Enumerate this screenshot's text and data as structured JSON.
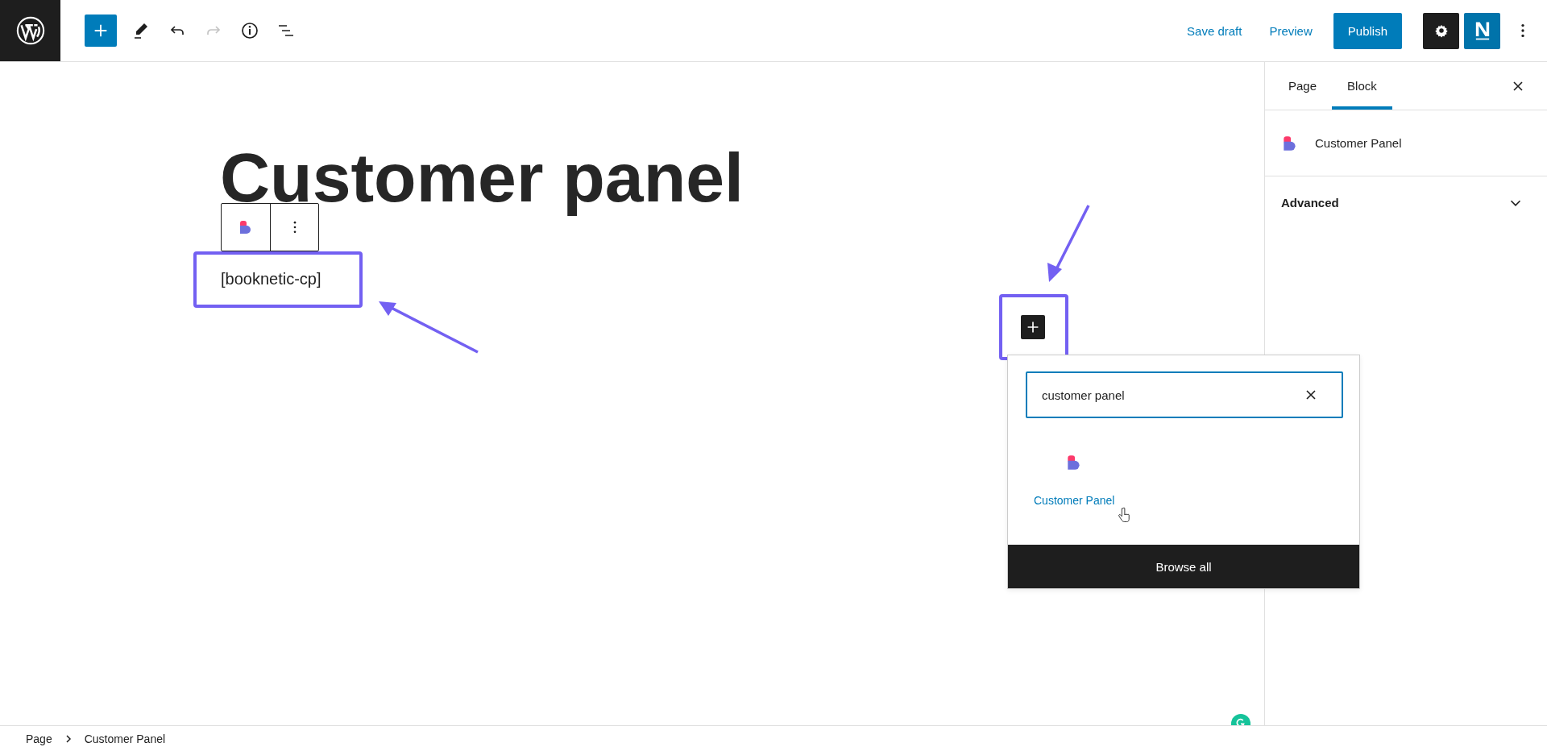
{
  "header": {
    "tools": [
      {
        "kind": "add"
      },
      {
        "kind": "edit"
      },
      {
        "kind": "undo",
        "disabled": false
      },
      {
        "kind": "redo",
        "disabled": true
      },
      {
        "kind": "info"
      },
      {
        "kind": "outline"
      }
    ],
    "save_draft": "Save draft",
    "preview": "Preview",
    "publish": "Publish"
  },
  "editor": {
    "title": "Customer panel",
    "shortcode": "[booknetic-cp]"
  },
  "inserter": {
    "search_value": "customer panel",
    "results": [
      {
        "label": "Customer Panel"
      }
    ],
    "browse_all": "Browse all"
  },
  "sidebar": {
    "tabs": [
      {
        "label": "Page",
        "selected": false
      },
      {
        "label": "Block",
        "selected": true
      }
    ],
    "block_name": "Customer Panel",
    "panels": [
      {
        "title": "Advanced",
        "expanded": false
      }
    ]
  },
  "breadcrumb": [
    "Page",
    "Customer Panel"
  ]
}
